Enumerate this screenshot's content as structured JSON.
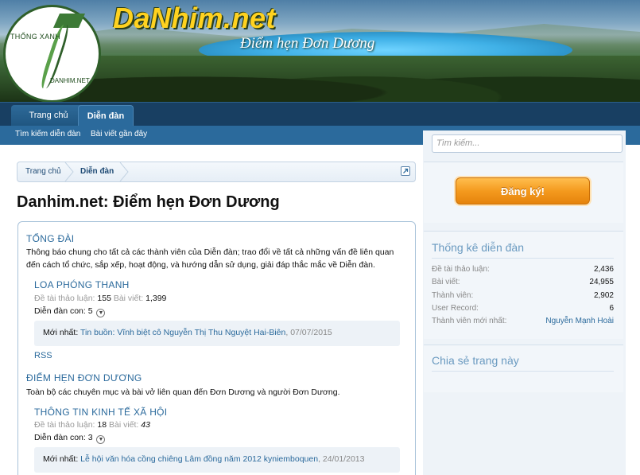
{
  "header": {
    "site_title": "DaNhim.net",
    "tagline": "Điểm hẹn Đơn Dương",
    "logo_text_top": "THỐNG XANH",
    "logo_text_bottom": "DANHIM.NET"
  },
  "nav": {
    "tabs": [
      {
        "label": "Trang chủ"
      },
      {
        "label": "Diễn đàn"
      }
    ],
    "subnav": [
      {
        "label": "Tìm kiếm diễn đàn"
      },
      {
        "label": "Bài viết gần đây"
      }
    ]
  },
  "breadcrumb": {
    "items": [
      {
        "label": "Trang chủ"
      },
      {
        "label": "Diễn đàn"
      }
    ]
  },
  "page_title": "Danhim.net: Điểm hẹn Đơn Dương",
  "categories": [
    {
      "title": "TỔNG ĐÀI",
      "description": "Thông báo chung cho tất cả các thành viên của Diễn đàn; trao đổi về tất cả những vấn đề liên quan đến cách tổ chức, sắp xếp, hoạt động, và hướng dẫn sử dụng, giải đáp thắc mắc về Diễn đàn.",
      "node": {
        "title": "LOA PHÓNG THANH",
        "threads_label": "Đề tài thảo luận:",
        "threads": "155",
        "posts_label": "Bài viết:",
        "posts": "1,399",
        "subforums_label": "Diễn đàn con: 5",
        "latest_label": "Mới nhất:",
        "latest_title": "Tin buồn: Vĩnh biệt cô Nguyễn Thị Thu Nguyệt Hai-Biên",
        "latest_date": "07/07/2015"
      },
      "rss": "RSS"
    },
    {
      "title": "ĐIỂM HẸN ĐƠN DƯƠNG",
      "description": "Toàn bộ các chuyên mục và bài vở liên quan đến Đơn Dương và người Đơn Dương.",
      "node": {
        "title": "THÔNG TIN KINH TẾ XÃ HỘI",
        "threads_label": "Đề tài thảo luận:",
        "threads": "18",
        "posts_label": "Bài viết:",
        "posts": "43",
        "subforums_label": "Diễn đàn con: 3",
        "latest_label": "Mới nhất:",
        "latest_title": "Lễ hội văn hóa cồng chiêng Lâm đồng năm 2012 kyniemboquen",
        "latest_date": "24/01/2013"
      }
    }
  ],
  "sidebar": {
    "search_placeholder": "Tìm kiếm...",
    "signup_label": "Đăng ký!",
    "stats_heading": "Thống kê diễn đàn",
    "stats": [
      {
        "label": "Đề tài thảo luận:",
        "value": "2,436"
      },
      {
        "label": "Bài viết:",
        "value": "24,955"
      },
      {
        "label": "Thành viên:",
        "value": "2,902"
      },
      {
        "label": "User Record:",
        "value": "6"
      },
      {
        "label": "Thành viên mới nhất:",
        "value": "Nguyễn Mạnh Hoài"
      }
    ],
    "share_heading": "Chia sẻ trang này"
  }
}
